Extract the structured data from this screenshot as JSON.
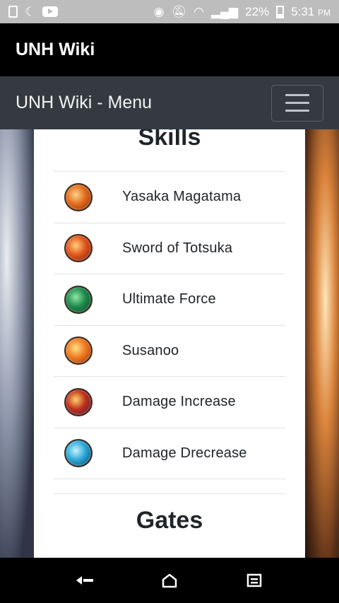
{
  "status_bar": {
    "battery": "22%",
    "time": "5:31",
    "time_suffix": "PM"
  },
  "app_header": {
    "title": "UNH Wiki"
  },
  "navbar": {
    "brand": "UNH Wiki - Menu"
  },
  "sections": {
    "skills_title": "Skills",
    "gates_title": "Gates"
  },
  "skills": [
    {
      "label": "Yasaka Magatama",
      "icon": "yasaka-magatama-icon",
      "colors": [
        "#fbd48a",
        "#e36a1c",
        "#7a2b0e"
      ]
    },
    {
      "label": "Sword of Totsuka",
      "icon": "sword-of-totsuka-icon",
      "colors": [
        "#ffcf7a",
        "#e0541d",
        "#6e1f0b"
      ]
    },
    {
      "label": "Ultimate Force",
      "icon": "ultimate-force-icon",
      "colors": [
        "#8ee6a6",
        "#1f8a4c",
        "#0c3a23"
      ]
    },
    {
      "label": "Susanoo",
      "icon": "susanoo-icon",
      "colors": [
        "#ffe08a",
        "#f07a1f",
        "#8a2c0c"
      ]
    },
    {
      "label": "Damage Increase",
      "icon": "damage-increase-icon",
      "colors": [
        "#ffd36b",
        "#c0301e",
        "#3a1a3e"
      ]
    },
    {
      "label": "Damage Drecrease",
      "icon": "damage-decrease-icon",
      "colors": [
        "#c9f4ff",
        "#2aa8d8",
        "#0b3550"
      ]
    }
  ]
}
